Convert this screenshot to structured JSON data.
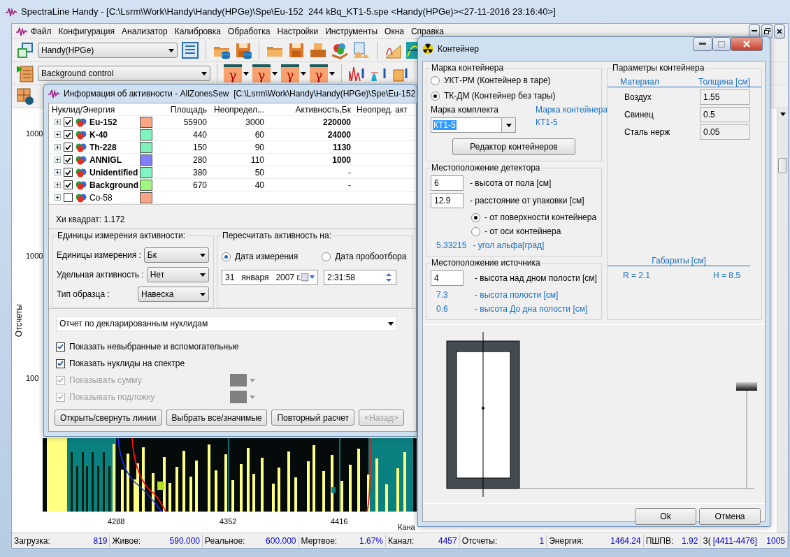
{
  "app": {
    "title": "SpectraLine Handy - [C:\\Lsrm\\Work\\Handy\\Handy(HPGe)\\Spe\\Eu-152  244 kBq_KT1-5.spe <Handy(HPGe)><27-11-2016 23:16:40>]"
  },
  "menu": [
    "Файл",
    "Конфигурация",
    "Анализатор",
    "Калибровка",
    "Обработка",
    "Настройки",
    "Инструменты",
    "Окна",
    "Справка"
  ],
  "toolbar": {
    "config_combo": "Handy(HPGe)",
    "mode_combo": "Background control",
    "gamma_buttons": [
      "γ",
      "γ",
      "γ",
      "γ"
    ]
  },
  "chart": {
    "y_label": "Отсчеты",
    "y_ticks": [
      "1000",
      "1000",
      "100"
    ],
    "x_ticks": [
      "4288",
      "4352",
      "4416"
    ],
    "x_label": "Кана"
  },
  "status_bar": [
    {
      "label": "Загрузка:",
      "value": "819"
    },
    {
      "label": "Живое:",
      "value": "590.000"
    },
    {
      "label": "Реальное:",
      "value": "600.000"
    },
    {
      "label": "Мертвое:",
      "value": "1.67%"
    },
    {
      "label": "Канал:",
      "value": "4457"
    },
    {
      "label": "Отсчеты:",
      "value": "1"
    },
    {
      "label": "Энергия:",
      "value": "1464.24"
    },
    {
      "label": "ПШПВ:",
      "value": "1.92"
    },
    {
      "label": "З(",
      "value": "[4411-4476]",
      "extra": "1005"
    }
  ],
  "activity_dialog": {
    "title": "Информация об активности - AllZonesSew  [C:\\Lsrm\\Work\\Handy\\Handy(HPGe)\\Spe\\Eu-152",
    "columns": [
      "Нуклид/Энергия",
      "Площадь",
      "Неопредел...",
      "Активность,Бк",
      "Неопред. акт"
    ],
    "rows": [
      {
        "name": "Eu-152",
        "checked": true,
        "color": "#f9a584",
        "area": "55900",
        "uncertainty": "3000",
        "activity": "220000"
      },
      {
        "name": "K-40",
        "checked": true,
        "color": "#80f5c0",
        "area": "440",
        "uncertainty": "60",
        "activity": "24000"
      },
      {
        "name": "Th-228",
        "checked": true,
        "color": "#80f0b8",
        "area": "150",
        "uncertainty": "90",
        "activity": "1130"
      },
      {
        "name": "ANNIGL",
        "checked": true,
        "color": "#8080f8",
        "area": "280",
        "uncertainty": "110",
        "activity": "1000"
      },
      {
        "name": "Unidentified",
        "checked": true,
        "color": "#80f5c1",
        "area": "380",
        "uncertainty": "50",
        "activity": "-"
      },
      {
        "name": "Background",
        "checked": true,
        "color": "#a0f880",
        "area": "670",
        "uncertainty": "40",
        "activity": "-"
      },
      {
        "name": "Co-58",
        "checked": false,
        "color": "#f9a585"
      }
    ],
    "chi_square": "Хи квадрат: 1.172",
    "units_group": {
      "title": "Единицы измерения активности:",
      "fields": [
        {
          "label": "Единицы измерения :",
          "value": "Бк"
        },
        {
          "label": "Удельная активность :",
          "value": "Нет"
        },
        {
          "label": "Тип образца :",
          "value": "Навеска"
        }
      ]
    },
    "recalc_group": {
      "title": "Пересчитать активность на:",
      "options": [
        {
          "label": "Дата измерения",
          "selected": true
        },
        {
          "label": "Дата пробоотбора",
          "selected": false
        }
      ],
      "date": "31   января   2007 г.",
      "time": "2:31:58"
    },
    "report": "Отчет по декларированным нуклидам",
    "options": [
      {
        "label": "Показать невыбранные и вспомогательные",
        "checked": true,
        "disabled": false
      },
      {
        "label": "Показать нуклиды на спектре",
        "checked": true,
        "disabled": false
      },
      {
        "label": "Показывать сумму",
        "checked": true,
        "disabled": true
      },
      {
        "label": "Показывать подложку",
        "checked": true,
        "disabled": true
      }
    ],
    "buttons": [
      {
        "label": "Открыть/свернуть линии",
        "disabled": false
      },
      {
        "label": "Выбрать все/значимые",
        "disabled": false
      },
      {
        "label": "Повторный расчет",
        "disabled": false
      },
      {
        "label": "<Назад>",
        "disabled": true
      }
    ]
  },
  "container_dialog": {
    "title": "Контейнер",
    "brand_group": {
      "title": "Марка контейнера",
      "options": [
        {
          "label": "УКТ-РМ (Контейнер в таре)",
          "selected": false
        },
        {
          "label": "ТК-ДМ (Контейнер без тары)",
          "selected": true
        }
      ],
      "kit_label": "Марка комплекта",
      "kit_value": "КТ1-5",
      "container_label": "Марка контейнера",
      "container_value": "КТ1-5",
      "editor_button": "Редактор контейнеров"
    },
    "detector_group": {
      "title": "Местоположение детектора",
      "fields": [
        {
          "value": "6",
          "label": "- высота от пола [см]"
        },
        {
          "value": "12.9",
          "label": "- расстояние от упаковки [см]"
        }
      ],
      "options": [
        {
          "label": "- от поверхности контейнера",
          "selected": true
        },
        {
          "label": "- от оси контейнера",
          "selected": false
        }
      ],
      "angle": {
        "value": "5.33215",
        "label": "- угол альфа[град]"
      }
    },
    "source_group": {
      "title": "Местоположение источника",
      "field": {
        "value": "4",
        "label": "- высота над дном полости [см]"
      },
      "readouts": [
        {
          "value": "7.3",
          "label": "- высота полости [см]"
        },
        {
          "value": "0.6",
          "label": "- высота До дна полости [см]"
        }
      ]
    },
    "params_group": {
      "title": "Параметры контейнера",
      "columns": [
        "Материал",
        "Толщина [см]"
      ],
      "layers": [
        {
          "material": "Воздух",
          "thickness": "1.55"
        },
        {
          "material": "Свинец",
          "thickness": "0.5"
        },
        {
          "material": "Сталь нерж",
          "thickness": "0.05"
        }
      ],
      "size_title": "Габариты [см]",
      "sizes": [
        "R = 2.1",
        "H = 8.5"
      ]
    },
    "buttons": [
      "Ok",
      "Отмена"
    ]
  }
}
